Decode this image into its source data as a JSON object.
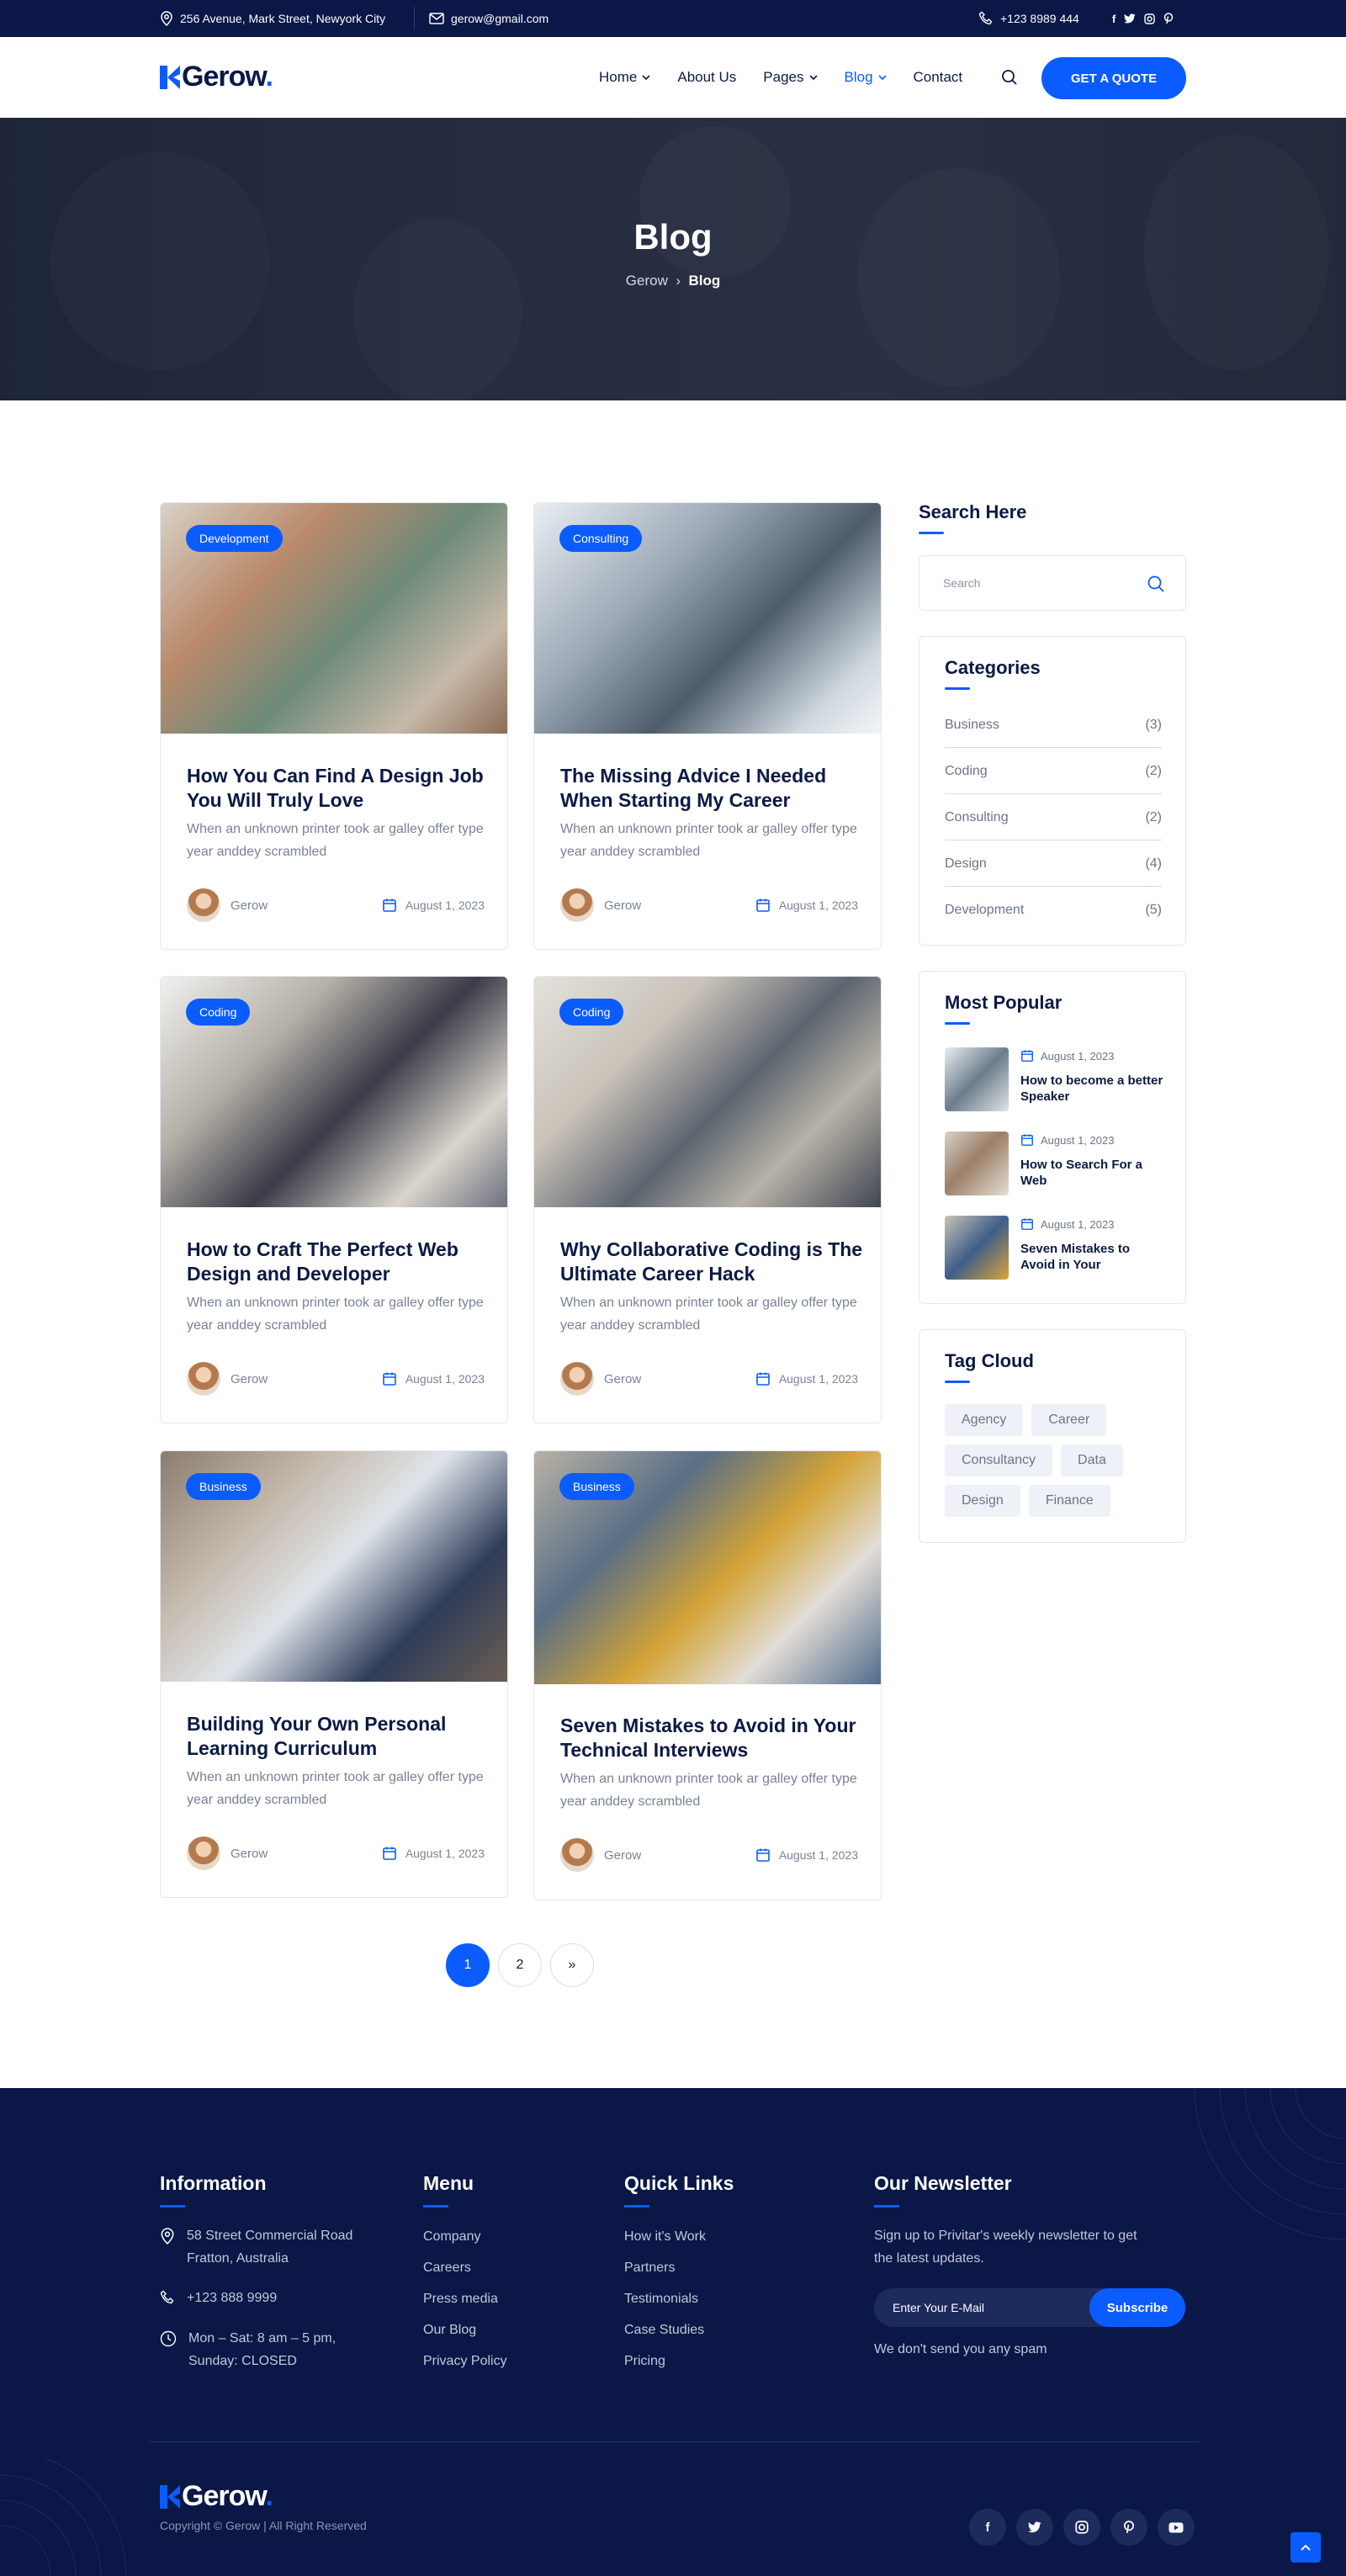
{
  "topbar": {
    "address": "256 Avenue, Mark Street, Newyork City",
    "email": "gerow@gmail.com",
    "phone": "+123 8989 444",
    "social": [
      "f",
      "t",
      "ig",
      "p"
    ]
  },
  "header": {
    "logo": "Gerow",
    "logo_dot": ".",
    "nav": [
      {
        "label": "Home"
      },
      {
        "label": "About Us"
      },
      {
        "label": "Pages"
      },
      {
        "label": "Blog"
      },
      {
        "label": "Contact"
      }
    ],
    "cta": "GET A QUOTE"
  },
  "hero": {
    "title": "Blog",
    "crumb_home": "Gerow",
    "crumb_sep": "›",
    "crumb_current": "Blog"
  },
  "posts": [
    {
      "category": "Development",
      "title": "How You Can Find A Design Job You Will Truly Love",
      "excerpt": "When an unknown printer took ar galley offer type year anddey scrambled",
      "author": "Gerow",
      "date": "August 1, 2023"
    },
    {
      "category": "Consulting",
      "title": "The Missing Advice I Needed When Starting My Career",
      "excerpt": "When an unknown printer took ar galley offer type year anddey scrambled",
      "author": "Gerow",
      "date": "August 1, 2023"
    },
    {
      "category": "Coding",
      "title": "How to Craft The Perfect Web Design and Developer",
      "excerpt": "When an unknown printer took ar galley offer type year anddey scrambled",
      "author": "Gerow",
      "date": "August 1, 2023"
    },
    {
      "category": "Coding",
      "title": "Why Collaborative Coding is The Ultimate Career Hack",
      "excerpt": "When an unknown printer took ar galley offer type year anddey scrambled",
      "author": "Gerow",
      "date": "August 1, 2023"
    },
    {
      "category": "Business",
      "title": "Building Your Own Personal Learning Curriculum",
      "excerpt": "When an unknown printer took ar galley offer type year anddey scrambled",
      "author": "Gerow",
      "date": "August 1, 2023"
    },
    {
      "category": "Business",
      "title": "Seven Mistakes to Avoid in Your Technical Interviews",
      "excerpt": "When an unknown printer took ar galley offer type year anddey scrambled",
      "author": "Gerow",
      "date": "August 1, 2023"
    }
  ],
  "pagination": {
    "pages": [
      "1",
      "2"
    ],
    "next": "»",
    "current": "1"
  },
  "sidebar": {
    "search": {
      "heading": "Search Here",
      "placeholder": "Search"
    },
    "categories": {
      "heading": "Categories",
      "items": [
        {
          "name": "Business",
          "count": "(3)"
        },
        {
          "name": "Coding",
          "count": "(2)"
        },
        {
          "name": "Consulting",
          "count": "(2)"
        },
        {
          "name": "Design",
          "count": "(4)"
        },
        {
          "name": "Development",
          "count": "(5)"
        }
      ]
    },
    "popular": {
      "heading": "Most Popular",
      "items": [
        {
          "date": "August 1, 2023",
          "title": "How to become a better Speaker"
        },
        {
          "date": "August 1, 2023",
          "title": "How to Search For a Web"
        },
        {
          "date": "August 1, 2023",
          "title": "Seven Mistakes to Avoid in Your"
        }
      ]
    },
    "tags": {
      "heading": "Tag Cloud",
      "items": [
        "Agency",
        "Career",
        "Consultancy",
        "Data",
        "Design",
        "Finance"
      ]
    }
  },
  "footer": {
    "information": {
      "heading": "Information",
      "address": "58 Street Commercial Road Fratton, Australia",
      "phone": "+123 888 9999",
      "hours": "Mon – Sat: 8 am – 5 pm, Sunday: CLOSED"
    },
    "menu": {
      "heading": "Menu",
      "items": [
        "Company",
        "Careers",
        "Press media",
        "Our Blog",
        "Privacy Policy"
      ]
    },
    "quick_links": {
      "heading": "Quick Links",
      "items": [
        "How it's Work",
        "Partners",
        "Testimonials",
        "Case Studies",
        "Pricing"
      ]
    },
    "newsletter": {
      "heading": "Our Newsletter",
      "text": "Sign up to Privitar's weekly newsletter to get the latest updates.",
      "placeholder": "Enter Your E-Mail",
      "button": "Subscribe",
      "note": "We don't send you any spam"
    },
    "logo": "Gerow",
    "logo_dot": ".",
    "copyright": "Copyright © Gerow | All Right Reserved",
    "social": [
      "f",
      "t",
      "ig",
      "p",
      "yt"
    ]
  },
  "colors": {
    "primary": "#0a5cff",
    "navy": "#0a1747",
    "text": "#0b1a45",
    "muted": "#7a8297"
  }
}
